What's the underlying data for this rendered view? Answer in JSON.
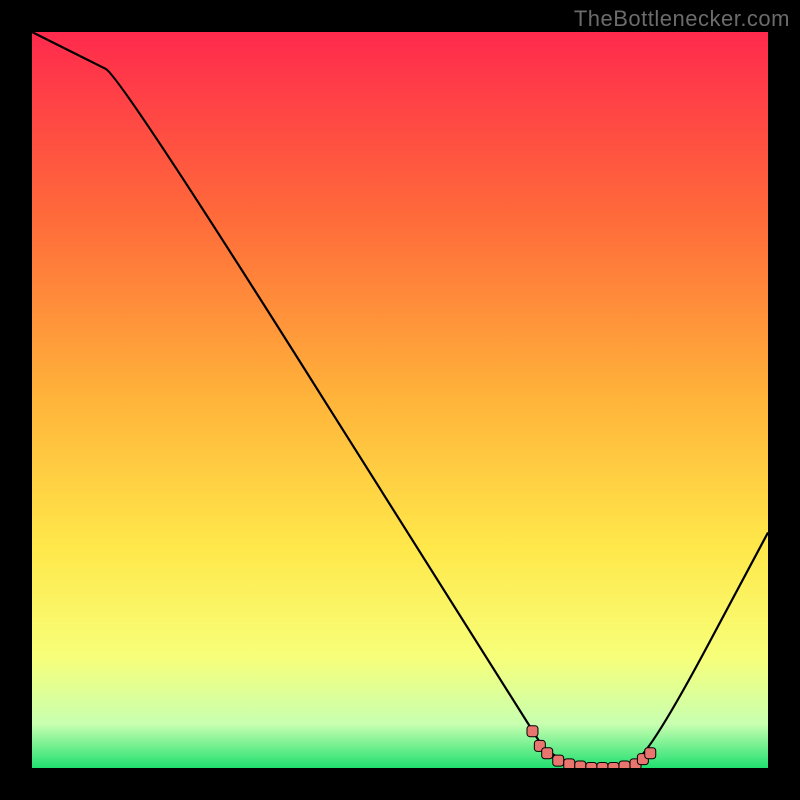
{
  "watermark": "TheBottlenecker.com",
  "colors": {
    "bg_outer": "#000000",
    "gradient_top": "#ff2a4d",
    "gradient_mid1": "#ff6a3a",
    "gradient_mid2": "#ffb43a",
    "gradient_mid3": "#ffe84a",
    "gradient_mid4": "#f7ff7a",
    "gradient_low1": "#c8ffb0",
    "gradient_bottom": "#20e070",
    "curve": "#000000",
    "marker_fill": "#e9766e",
    "marker_stroke": "#000000"
  },
  "chart_data": {
    "type": "line",
    "title": "",
    "xlabel": "",
    "ylabel": "",
    "xlim": [
      0,
      100
    ],
    "ylim": [
      0,
      100
    ],
    "grid": false,
    "legend": false,
    "series": [
      {
        "name": "bottleneck-curve",
        "x": [
          0,
          4,
          8,
          12,
          68,
          70,
          75,
          80,
          84,
          100
        ],
        "y": [
          100,
          98,
          96,
          94,
          5,
          2,
          0,
          0,
          2,
          32
        ]
      }
    ],
    "markers": {
      "name": "optimal-range",
      "points": [
        {
          "x": 68,
          "y": 5
        },
        {
          "x": 69,
          "y": 3
        },
        {
          "x": 70,
          "y": 2
        },
        {
          "x": 71.5,
          "y": 1
        },
        {
          "x": 73,
          "y": 0.5
        },
        {
          "x": 74.5,
          "y": 0.2
        },
        {
          "x": 76,
          "y": 0
        },
        {
          "x": 77.5,
          "y": 0
        },
        {
          "x": 79,
          "y": 0
        },
        {
          "x": 80.5,
          "y": 0.2
        },
        {
          "x": 82,
          "y": 0.5
        },
        {
          "x": 83,
          "y": 1.2
        },
        {
          "x": 84,
          "y": 2
        }
      ]
    }
  }
}
